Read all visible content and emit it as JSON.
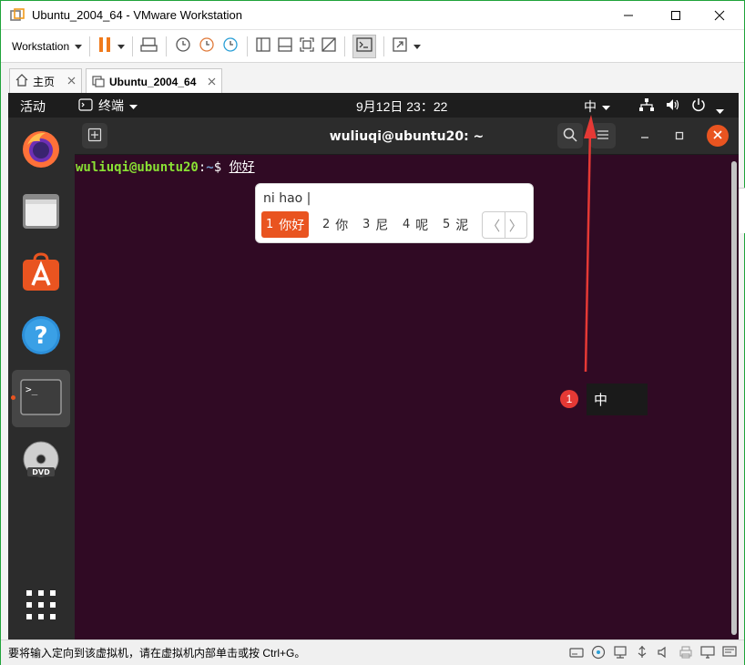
{
  "window": {
    "title": "Ubuntu_2004_64 - VMware Workstation"
  },
  "toolbar": {
    "workstation_label": "Workstation"
  },
  "tabs": [
    {
      "label": "主页"
    },
    {
      "label": "Ubuntu_2004_64"
    }
  ],
  "guest": {
    "topbar": {
      "activities": "活动",
      "terminal_menu": "终端",
      "clock": "9月12日  23：22",
      "ime": "中"
    },
    "terminal": {
      "title": "wuliuqi@ubuntu20: ~",
      "prompt_user": "wuliuqi@ubuntu20",
      "prompt_colon": ":",
      "prompt_path": "~",
      "prompt_dollar": "$ ",
      "typed_text": "你好"
    },
    "ime_popup": {
      "input": "ni hao |",
      "candidates": [
        {
          "num": "1",
          "text": "你好"
        },
        {
          "num": "2",
          "text": "你"
        },
        {
          "num": "3",
          "text": "尼"
        },
        {
          "num": "4",
          "text": "呢"
        },
        {
          "num": "5",
          "text": "泥"
        }
      ],
      "prev": "〈",
      "next": "〉"
    }
  },
  "annotation": {
    "badge": "1",
    "label": "中"
  },
  "statusbar": {
    "message": "要将输入定向到该虚拟机，请在虚拟机内部单击或按 Ctrl+G。"
  },
  "colors": {
    "accent": "#e95420",
    "frame": "#1fa33a",
    "arrow": "#e53935"
  }
}
